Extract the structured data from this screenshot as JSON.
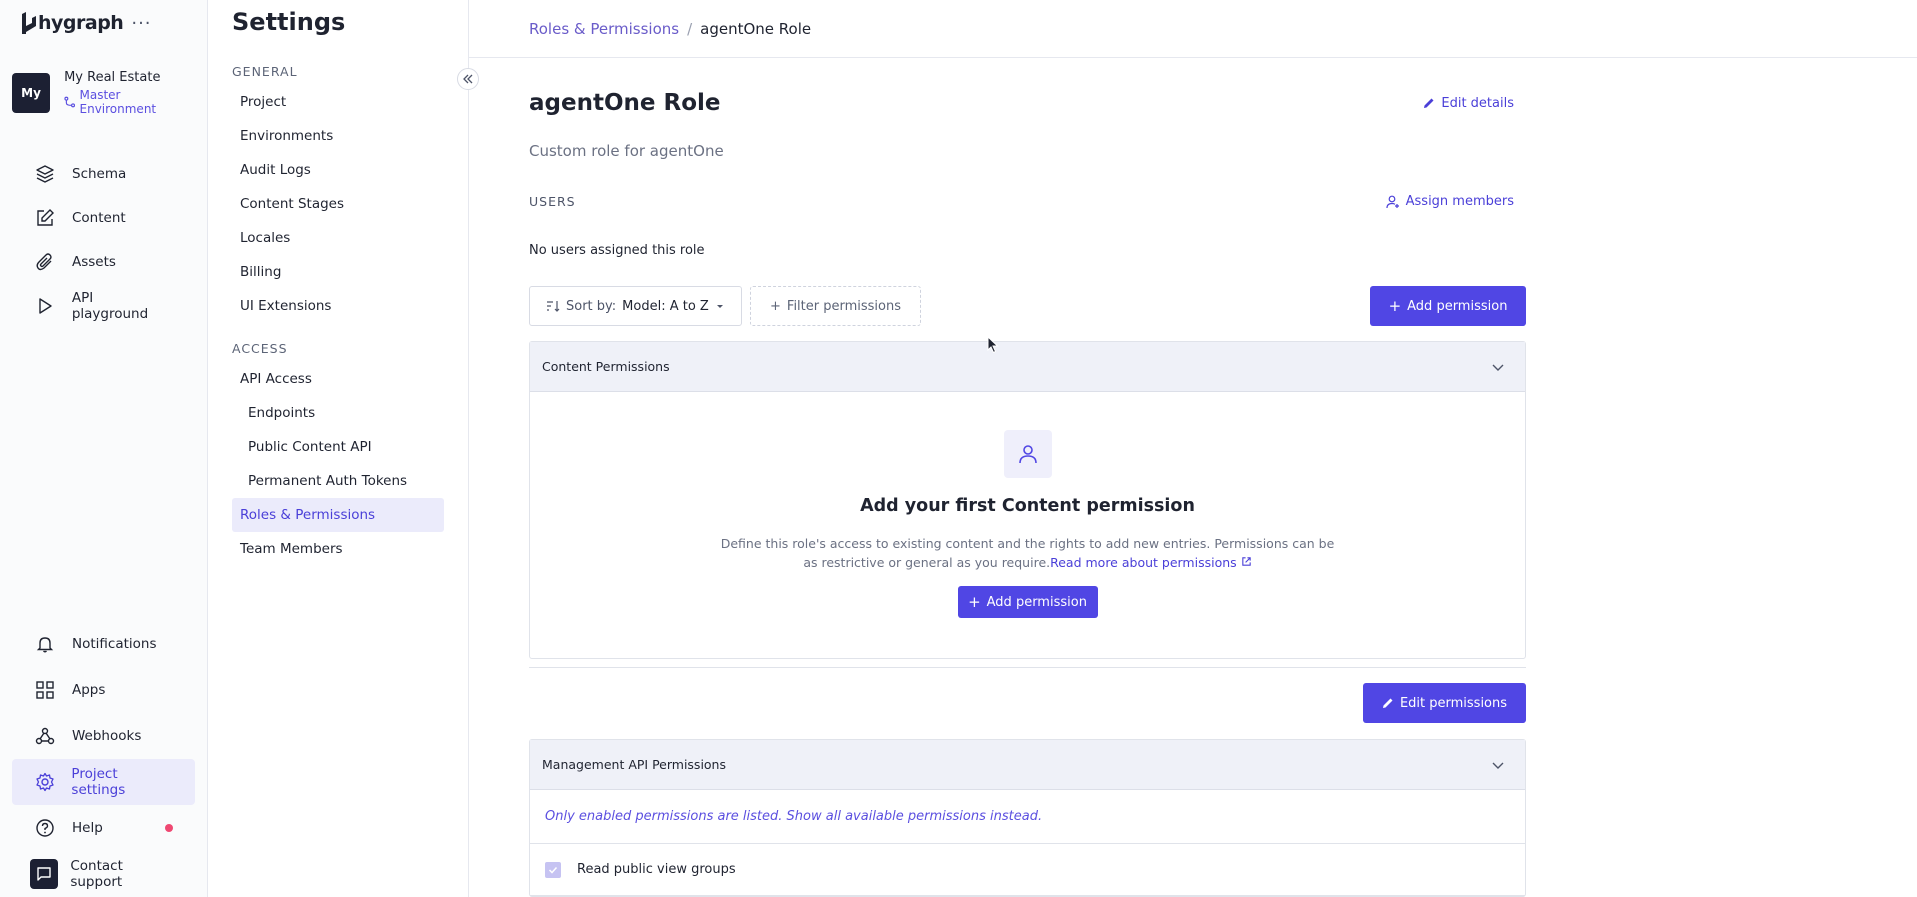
{
  "brand": {
    "name": "hygraph",
    "more": "···"
  },
  "project": {
    "avatar": "My",
    "name": "My Real Estate",
    "environment": "Master Environment"
  },
  "nav": {
    "main": [
      {
        "label": "Schema",
        "icon": "layers-icon"
      },
      {
        "label": "Content",
        "icon": "edit-icon"
      },
      {
        "label": "Assets",
        "icon": "paperclip-icon"
      },
      {
        "label": "API playground",
        "icon": "play-icon"
      }
    ],
    "bottom": [
      {
        "label": "Notifications",
        "icon": "bell-icon"
      },
      {
        "label": "Apps",
        "icon": "apps-grid-icon"
      },
      {
        "label": "Webhooks",
        "icon": "webhook-icon"
      },
      {
        "label": "Project settings",
        "icon": "gear-icon",
        "active": true
      },
      {
        "label": "Help",
        "icon": "help-icon"
      },
      {
        "label": "Contact support",
        "icon": "chat-icon"
      }
    ]
  },
  "settings": {
    "title": "Settings",
    "general_label": "GENERAL",
    "general": [
      "Project",
      "Environments",
      "Audit Logs",
      "Content Stages",
      "Locales",
      "Billing",
      "UI Extensions"
    ],
    "access_label": "ACCESS",
    "access": [
      "API Access",
      "Endpoints",
      "Public Content API",
      "Permanent Auth Tokens",
      "Roles & Permissions",
      "Team Members"
    ]
  },
  "breadcrumb": {
    "parent": "Roles & Permissions",
    "sep": "/",
    "current": "agentOne Role"
  },
  "role": {
    "title": "agentOne Role",
    "edit_details": "Edit details",
    "description": "Custom role for agentOne",
    "users_label": "USERS",
    "assign_members": "Assign members",
    "no_users": "No users assigned this role"
  },
  "toolbar": {
    "sort_prefix": "Sort by:",
    "sort_value": "Model: A to Z",
    "filter": "Filter permissions",
    "add_permission": "Add permission"
  },
  "content_permissions": {
    "header": "Content Permissions",
    "empty_title": "Add your first Content permission",
    "empty_text": "Define this role's access to existing content and the rights to add new entries. Permissions can be as restrictive or general as you require.",
    "read_more": "Read more about permissions",
    "add_permission": "Add permission"
  },
  "edit_permissions": "Edit permissions",
  "management_permissions": {
    "header": "Management API Permissions",
    "note_prefix": "Only enabled permissions are listed.",
    "note_link": "Show all available permissions instead.",
    "items": [
      {
        "label": "Read public view groups",
        "checked": true
      }
    ]
  },
  "colors": {
    "accent": "#5046e4",
    "active_bg": "#ebebfb",
    "panel_header": "#eff1f8",
    "dark": "#1c2033",
    "notification_dot": "#ef4872"
  }
}
